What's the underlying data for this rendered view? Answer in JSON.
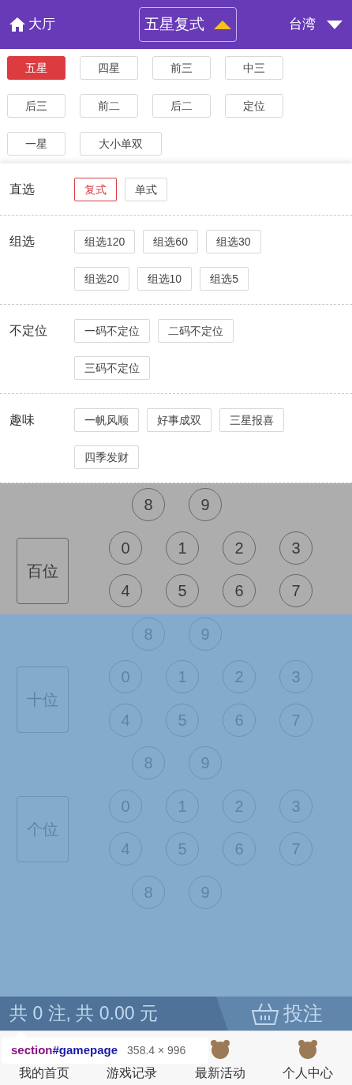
{
  "header": {
    "back_label": "大厅",
    "title": "五星复式",
    "title_expanded": true,
    "region": "台湾"
  },
  "play_tabs": [
    {
      "label": "五星",
      "selected": true
    },
    {
      "label": "四星",
      "selected": false
    },
    {
      "label": "前三",
      "selected": false
    },
    {
      "label": "中三",
      "selected": false
    },
    {
      "label": "后三",
      "selected": false
    },
    {
      "label": "前二",
      "selected": false
    },
    {
      "label": "后二",
      "selected": false
    },
    {
      "label": "定位",
      "selected": false
    },
    {
      "label": "一星",
      "selected": false
    },
    {
      "label": "大小单双",
      "selected": false
    }
  ],
  "play_menu": [
    {
      "label": "直选",
      "options": [
        {
          "label": "复式",
          "selected": true
        },
        {
          "label": "单式",
          "selected": false
        }
      ]
    },
    {
      "label": "组选",
      "options": [
        {
          "label": "组选120",
          "selected": false
        },
        {
          "label": "组选60",
          "selected": false
        },
        {
          "label": "组选30",
          "selected": false
        },
        {
          "label": "组选20",
          "selected": false
        },
        {
          "label": "组选10",
          "selected": false
        },
        {
          "label": "组选5",
          "selected": false
        }
      ]
    },
    {
      "label": "不定位",
      "options": [
        {
          "label": "一码不定位",
          "selected": false
        },
        {
          "label": "二码不定位",
          "selected": false
        },
        {
          "label": "三码不定位",
          "selected": false
        }
      ]
    },
    {
      "label": "趣味",
      "options": [
        {
          "label": "一帆风顺",
          "selected": false
        },
        {
          "label": "好事成双",
          "selected": false
        },
        {
          "label": "三星报喜",
          "selected": false
        },
        {
          "label": "四季发财",
          "selected": false
        }
      ]
    }
  ],
  "positions": [
    {
      "rows": [
        [
          "8",
          "9"
        ]
      ]
    },
    {
      "label": "百位",
      "rows": [
        [
          "0",
          "1",
          "2",
          "3"
        ],
        [
          "4",
          "5",
          "6",
          "7"
        ],
        [
          "8",
          "9"
        ]
      ]
    },
    {
      "label": "十位",
      "rows": [
        [
          "0",
          "1",
          "2",
          "3"
        ],
        [
          "4",
          "5",
          "6",
          "7"
        ],
        [
          "8",
          "9"
        ]
      ]
    },
    {
      "label": "个位",
      "rows": [
        [
          "0",
          "1",
          "2",
          "3"
        ],
        [
          "4",
          "5",
          "6",
          "7"
        ],
        [
          "8",
          "9"
        ]
      ]
    }
  ],
  "bet_bar": {
    "summary": "共 0 注, 共 0.00 元",
    "submit": "投注"
  },
  "bottom_nav": [
    {
      "label": "我的首页",
      "kind": "text"
    },
    {
      "label": "游戏记录",
      "kind": "text"
    },
    {
      "label": "最新活动",
      "kind": "iconed"
    },
    {
      "label": "个人中心",
      "kind": "iconed"
    }
  ],
  "devtools_tooltip": {
    "tag": "section",
    "id": "#gamepage",
    "size": "358.4 × 996"
  }
}
